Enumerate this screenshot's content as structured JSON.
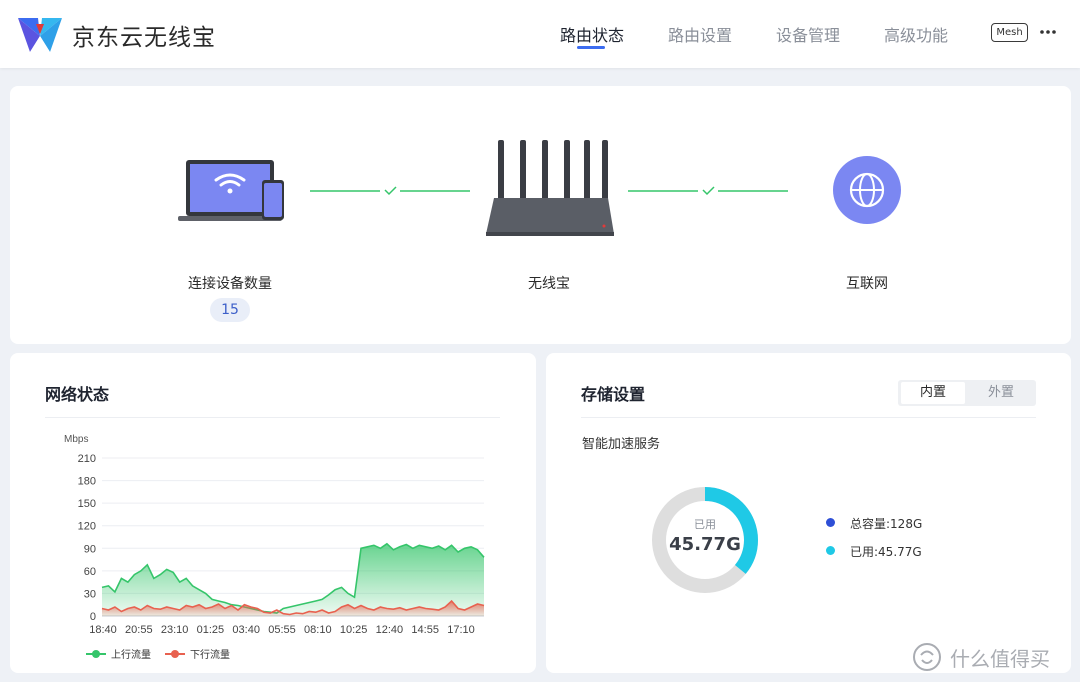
{
  "header": {
    "app_title": "京东云无线宝",
    "tabs": [
      {
        "label": "路由状态",
        "active": true
      },
      {
        "label": "路由设置",
        "active": false
      },
      {
        "label": "设备管理",
        "active": false
      },
      {
        "label": "高级功能",
        "active": false
      }
    ],
    "mesh_label": "Mesh",
    "more_icon": "more-horizontal-icon",
    "accent_color": "#3c6cf0"
  },
  "topology": {
    "devices_label": "连接设备数量",
    "device_count": "15",
    "router_label": "无线宝",
    "internet_label": "互联网",
    "link_status_color": "#35c56a"
  },
  "network": {
    "title": "网络状态",
    "legend_up": "上行流量",
    "legend_down": "下行流量"
  },
  "chart_data": {
    "type": "area",
    "ylabel": "Mbps",
    "ylim": [
      0,
      210
    ],
    "yticks": [
      0,
      30,
      60,
      90,
      120,
      150,
      180,
      210
    ],
    "xticks": [
      "18:40",
      "20:55",
      "23:10",
      "01:25",
      "03:40",
      "05:55",
      "08:10",
      "10:25",
      "12:40",
      "14:55",
      "17:10"
    ],
    "series": [
      {
        "name": "上行流量",
        "color": "#35c56a",
        "values": [
          38,
          40,
          32,
          50,
          45,
          55,
          60,
          68,
          50,
          55,
          62,
          58,
          45,
          50,
          40,
          35,
          30,
          22,
          20,
          18,
          15,
          14,
          12,
          10,
          8,
          6,
          5,
          4,
          10,
          12,
          14,
          16,
          18,
          20,
          22,
          28,
          35,
          38,
          30,
          25,
          90,
          92,
          94,
          90,
          96,
          88,
          92,
          95,
          90,
          94,
          92,
          90,
          93,
          88,
          94,
          85,
          90,
          92,
          88,
          78
        ]
      },
      {
        "name": "下行流量",
        "color": "#e8614f",
        "values": [
          10,
          8,
          12,
          6,
          10,
          12,
          8,
          14,
          10,
          9,
          12,
          10,
          8,
          14,
          12,
          15,
          10,
          12,
          16,
          10,
          14,
          8,
          15,
          12,
          10,
          5,
          4,
          8,
          3,
          2,
          4,
          3,
          6,
          5,
          8,
          4,
          6,
          12,
          15,
          10,
          14,
          10,
          8,
          12,
          10,
          9,
          11,
          8,
          10,
          12,
          10,
          9,
          8,
          12,
          20,
          10,
          8,
          12,
          16,
          14
        ]
      }
    ]
  },
  "storage": {
    "title": "存储设置",
    "seg_internal": "内置",
    "seg_external": "外置",
    "subtitle": "智能加速服务",
    "donut_label": "已用",
    "used_value": "45.77G",
    "used_fraction": 0.36,
    "legend_total": "总容量:128G",
    "legend_used": "已用:45.77G",
    "total_color": "#2e4fd6",
    "used_color": "#1fc9e6",
    "remaining_color": "#dedede"
  },
  "watermark": {
    "text": "什么值得买",
    "icon": "smzdm-logo-icon"
  }
}
